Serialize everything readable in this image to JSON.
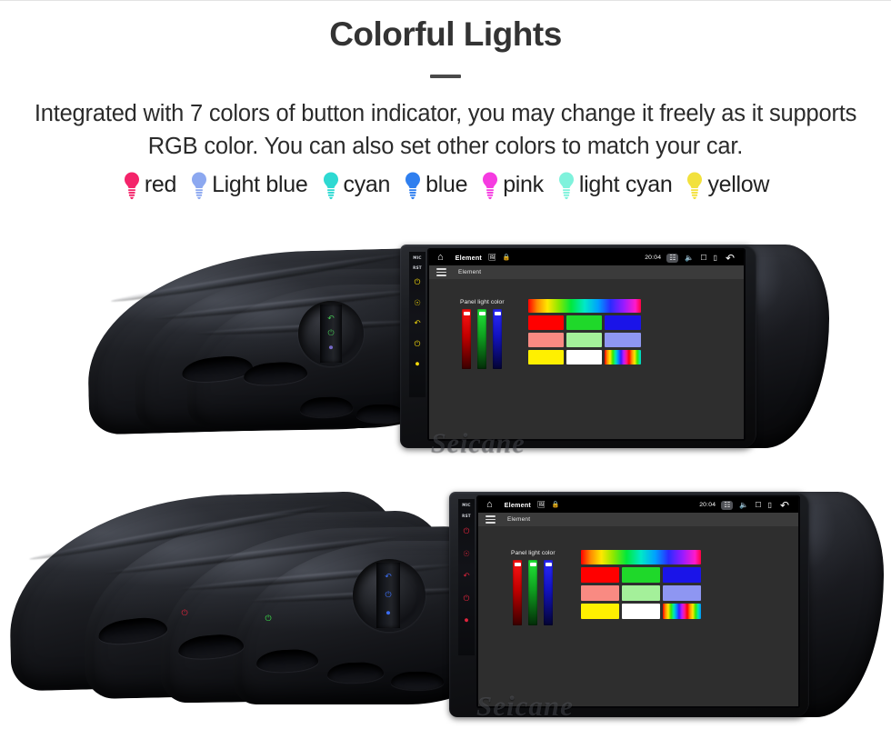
{
  "header": {
    "title": "Colorful Lights",
    "subtitle": "Integrated with 7 colors of button indicator, you may change it freely as it supports RGB color. You can also set other colors to match your car."
  },
  "legend": {
    "items": [
      {
        "label": "red",
        "color": "#F4246A",
        "icon": "bulb-icon"
      },
      {
        "label": "Light blue",
        "color": "#8CA8F0",
        "icon": "bulb-icon"
      },
      {
        "label": "cyan",
        "color": "#2ED9D2",
        "icon": "bulb-icon"
      },
      {
        "label": "blue",
        "color": "#2F7FEF",
        "icon": "bulb-icon"
      },
      {
        "label": "pink",
        "color": "#F53BE0",
        "icon": "bulb-icon"
      },
      {
        "label": "light cyan",
        "color": "#7FF2DC",
        "icon": "bulb-icon"
      },
      {
        "label": "yellow",
        "color": "#F2E13D",
        "icon": "bulb-icon"
      }
    ]
  },
  "photos": [
    {
      "id": "top",
      "watermark": "Seicane",
      "button_illumination_color": "#F5D90A",
      "panel_indicator_colors": [
        "#4ADE5A",
        "#8B7BF0"
      ],
      "unit": {
        "statusbar": {
          "home_icon": "home-icon",
          "title": "Element",
          "image_icon": "image-icon",
          "lock_icon": "lock-icon",
          "clock": "20:04",
          "icons": [
            "screenshot-icon",
            "speaker-icon",
            "screen-record-icon",
            "card-icon"
          ],
          "back_icon": "back-arrow-icon"
        },
        "appbar": {
          "menu_icon": "hamburger-icon",
          "title": "Element"
        },
        "dialog": {
          "title": "Panel light color",
          "sliders": [
            {
              "name": "red-slider",
              "color": "#FF0000",
              "value": 100
            },
            {
              "name": "green-slider",
              "color": "#00D820",
              "value": 100
            },
            {
              "name": "blue-slider",
              "color": "#1414FF",
              "value": 100
            }
          ],
          "swatches": [
            "#FF0000",
            "#1FD82A",
            "#1A14E8",
            "#F98A82",
            "#A4F09A",
            "#8E96F2",
            "#FFF000",
            "#FFFFFF",
            "rainbow"
          ]
        }
      },
      "side_keys": [
        "MIC",
        "RST",
        "power-icon",
        "home-icon",
        "back-icon",
        "volume-up-icon",
        "volume-down-icon"
      ]
    },
    {
      "id": "bottom",
      "watermark": "Seicane",
      "button_illumination_color": "#E0243C",
      "panel_indicator_colors": [
        "#E0243C",
        "#3BE04A",
        "#3A6CF0"
      ],
      "unit": {
        "statusbar": {
          "home_icon": "home-icon",
          "title": "Element",
          "image_icon": "image-icon",
          "lock_icon": "lock-icon",
          "clock": "20:04",
          "icons": [
            "screenshot-icon",
            "speaker-icon",
            "screen-record-icon",
            "card-icon"
          ],
          "back_icon": "back-arrow-icon"
        },
        "appbar": {
          "menu_icon": "hamburger-icon",
          "title": "Element"
        },
        "dialog": {
          "title": "Panel light color",
          "sliders": [
            {
              "name": "red-slider",
              "color": "#FF0000",
              "value": 100
            },
            {
              "name": "green-slider",
              "color": "#00D820",
              "value": 100
            },
            {
              "name": "blue-slider",
              "color": "#1414FF",
              "value": 100
            }
          ],
          "swatches": [
            "#FF0000",
            "#1FD82A",
            "#1A14E8",
            "#F98A82",
            "#A4F09A",
            "#8E96F2",
            "#FFF000",
            "#FFFFFF",
            "rainbow"
          ]
        }
      },
      "side_keys": [
        "MIC",
        "RST",
        "power-icon",
        "home-icon",
        "back-icon",
        "volume-up-icon",
        "volume-down-icon"
      ]
    }
  ]
}
